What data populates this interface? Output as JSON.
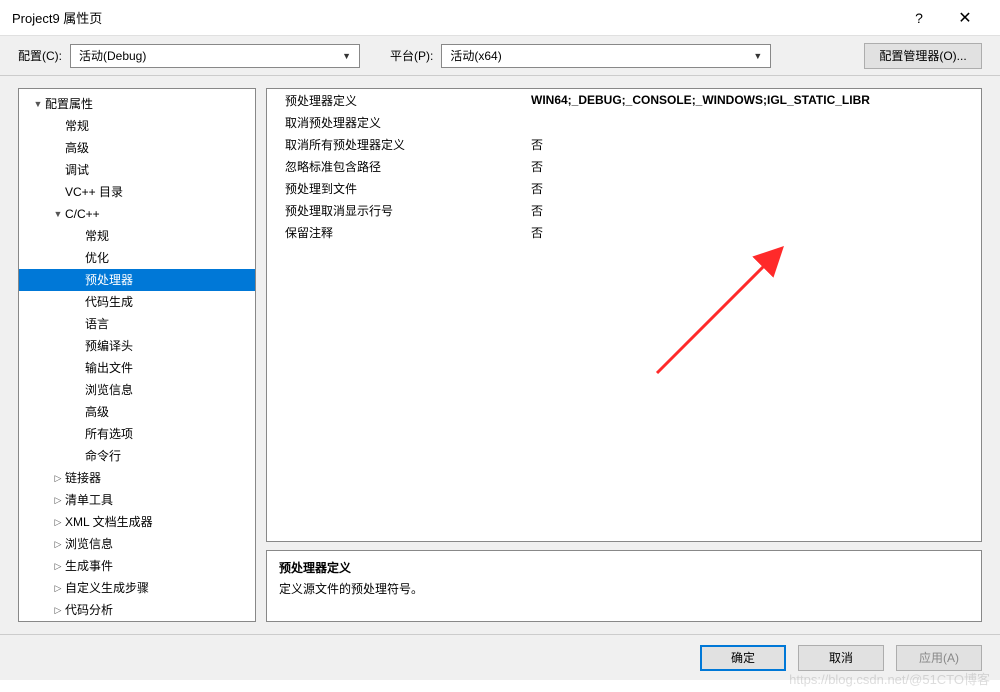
{
  "title": "Project9 属性页",
  "config_row": {
    "config_label": "配置(C):",
    "config_value": "活动(Debug)",
    "platform_label": "平台(P):",
    "platform_value": "活动(x64)",
    "manager_btn": "配置管理器(O)..."
  },
  "tree": [
    {
      "label": "配置属性",
      "indent": 0,
      "arrow": "▼"
    },
    {
      "label": "常规",
      "indent": 1,
      "arrow": ""
    },
    {
      "label": "高级",
      "indent": 1,
      "arrow": ""
    },
    {
      "label": "调试",
      "indent": 1,
      "arrow": ""
    },
    {
      "label": "VC++ 目录",
      "indent": 1,
      "arrow": ""
    },
    {
      "label": "C/C++",
      "indent": 1,
      "arrow": "▼"
    },
    {
      "label": "常规",
      "indent": 2,
      "arrow": ""
    },
    {
      "label": "优化",
      "indent": 2,
      "arrow": ""
    },
    {
      "label": "预处理器",
      "indent": 2,
      "arrow": "",
      "selected": true
    },
    {
      "label": "代码生成",
      "indent": 2,
      "arrow": ""
    },
    {
      "label": "语言",
      "indent": 2,
      "arrow": ""
    },
    {
      "label": "预编译头",
      "indent": 2,
      "arrow": ""
    },
    {
      "label": "输出文件",
      "indent": 2,
      "arrow": ""
    },
    {
      "label": "浏览信息",
      "indent": 2,
      "arrow": ""
    },
    {
      "label": "高级",
      "indent": 2,
      "arrow": ""
    },
    {
      "label": "所有选项",
      "indent": 2,
      "arrow": ""
    },
    {
      "label": "命令行",
      "indent": 2,
      "arrow": ""
    },
    {
      "label": "链接器",
      "indent": 1,
      "arrow": "▷"
    },
    {
      "label": "清单工具",
      "indent": 1,
      "arrow": "▷"
    },
    {
      "label": "XML 文档生成器",
      "indent": 1,
      "arrow": "▷"
    },
    {
      "label": "浏览信息",
      "indent": 1,
      "arrow": "▷"
    },
    {
      "label": "生成事件",
      "indent": 1,
      "arrow": "▷"
    },
    {
      "label": "自定义生成步骤",
      "indent": 1,
      "arrow": "▷"
    },
    {
      "label": "代码分析",
      "indent": 1,
      "arrow": "▷"
    }
  ],
  "grid": [
    {
      "name": "预处理器定义",
      "value": "WIN64;_DEBUG;_CONSOLE;_WINDOWS;IGL_STATIC_LIBR",
      "selected": true
    },
    {
      "name": "取消预处理器定义",
      "value": ""
    },
    {
      "name": "取消所有预处理器定义",
      "value": "否"
    },
    {
      "name": "忽略标准包含路径",
      "value": "否"
    },
    {
      "name": "预处理到文件",
      "value": "否"
    },
    {
      "name": "预处理取消显示行号",
      "value": "否"
    },
    {
      "name": "保留注释",
      "value": "否"
    }
  ],
  "desc": {
    "title": "预处理器定义",
    "text": "定义源文件的预处理符号。"
  },
  "footer": {
    "ok": "确定",
    "cancel": "取消",
    "apply": "应用(A)"
  },
  "watermark": "https://blog.csdn.net/@51CTO博客"
}
